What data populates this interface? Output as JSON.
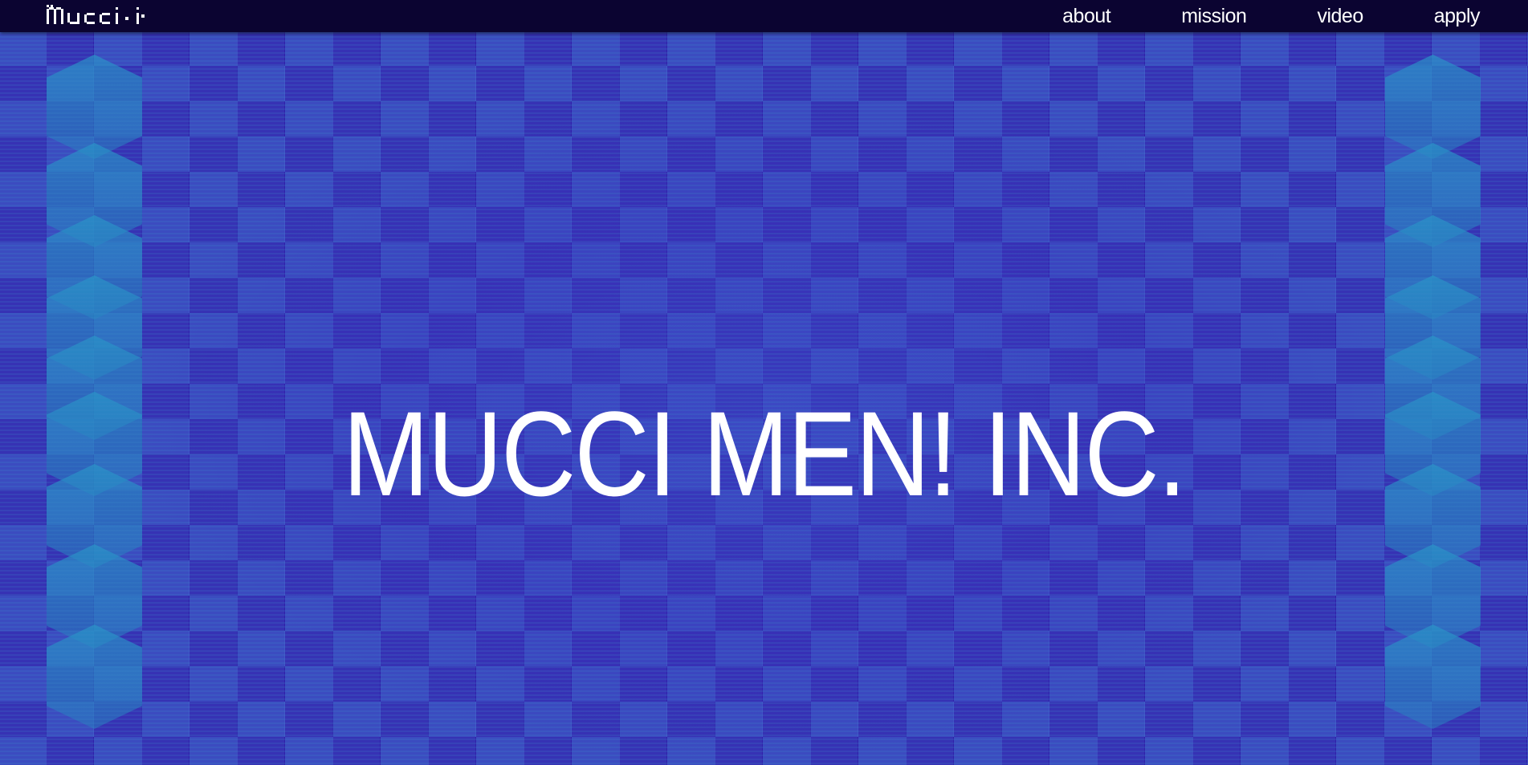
{
  "site": {
    "logo_text": "mucci"
  },
  "nav": {
    "items": [
      {
        "label": "about"
      },
      {
        "label": "mission"
      },
      {
        "label": "video"
      },
      {
        "label": "apply"
      }
    ]
  },
  "hero": {
    "title": "MUCCI MEN! INC."
  },
  "colors": {
    "navbar_bg": "#0b0431",
    "checker_dark": "#2a0f9e",
    "checker_light": "#3b4cc0",
    "accent_teal": "#2d8ccb",
    "text": "#ffffff"
  },
  "icons": {
    "logo": "mucci-pixel-logo-icon"
  }
}
